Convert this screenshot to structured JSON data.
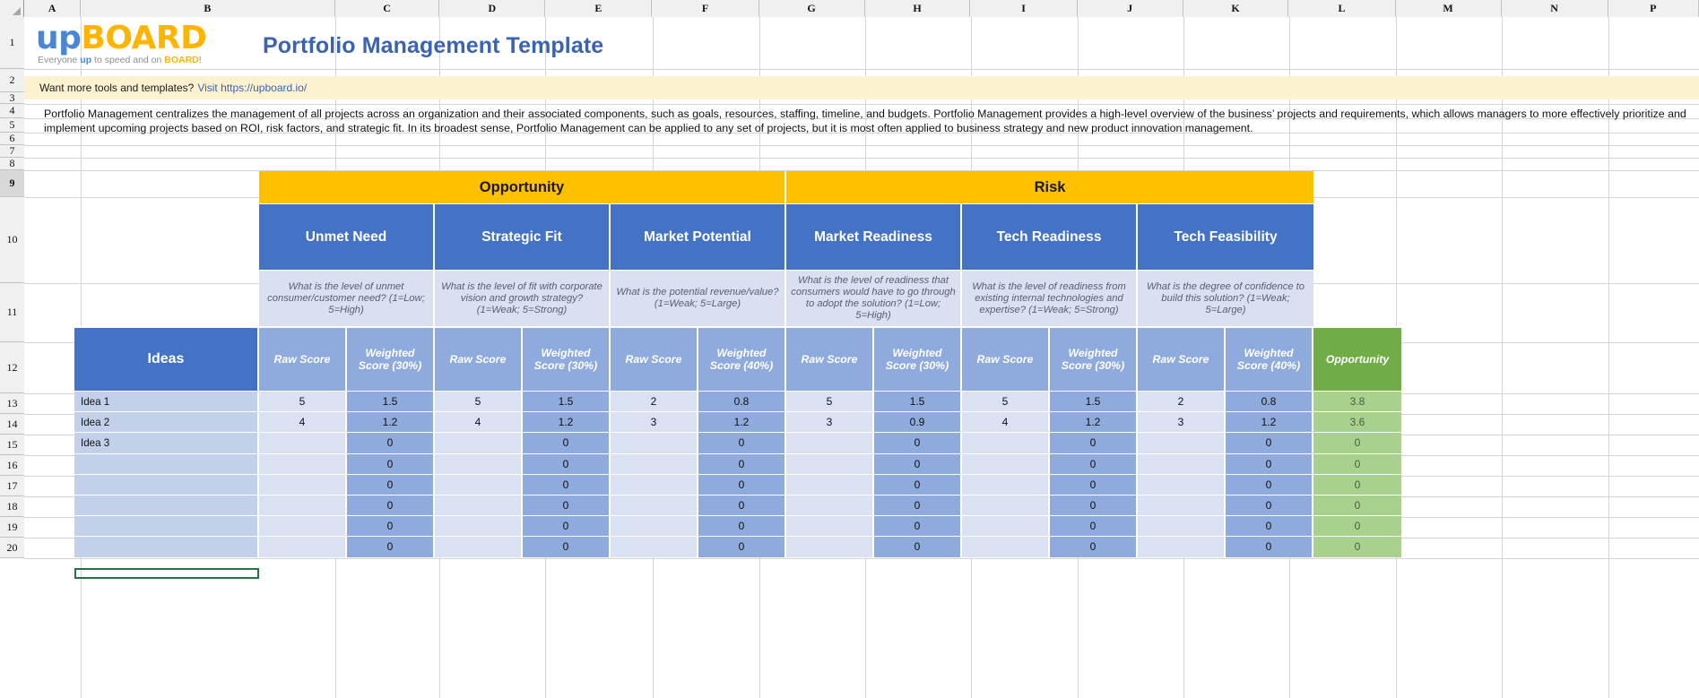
{
  "app": {
    "type": "spreadsheet",
    "select_all_icon": "select-all-triangle-icon"
  },
  "column_headers": [
    "A",
    "B",
    "C",
    "D",
    "E",
    "F",
    "G",
    "H",
    "I",
    "J",
    "K",
    "L",
    "M",
    "N",
    "P"
  ],
  "row_headers": [
    "1",
    "2",
    "3",
    "4",
    "5",
    "6",
    "7",
    "8",
    "9",
    "10",
    "11",
    "12",
    "13",
    "14",
    "15",
    "16",
    "17",
    "18",
    "19",
    "20"
  ],
  "selected_row": "9",
  "logo": {
    "up": "up",
    "board": "BOARD",
    "tagline_pre": "Everyone ",
    "tagline_up": "up",
    "tagline_mid": " to speed and on ",
    "tagline_board": "BOARD",
    "tagline_post": "!"
  },
  "title": "Portfolio Management Template",
  "banner": {
    "text": "Want more tools and templates?",
    "link_text": "Visit https://upboard.io/"
  },
  "description": {
    "line1": "Portfolio Management centralizes the management of all projects across an organization and their associated components, such as goals, resources, staffing, timeline, and budgets. Portfolio Management provides a high-level overview of the business’ projects and requirements, which allows managers to more effectively prioritize and",
    "line2": "implement upcoming projects based on ROI, risk factors, and strategic fit. In its broadest sense, Portfolio Management can be applied to any set of projects, but it is most often applied to business strategy and new product innovation management."
  },
  "matrix": {
    "groups": [
      {
        "label": "Opportunity",
        "span": 3
      },
      {
        "label": "Risk",
        "span": 3
      }
    ],
    "ideas_header": "Ideas",
    "raw_score_label": "Raw Score",
    "criteria": [
      {
        "name": "Unmet Need",
        "question": "What is the level of unmet consumer/customer need?",
        "scale": "(1=Low; 5=High)",
        "weighted_label": "Weighted Score (30%)",
        "weight": "30%"
      },
      {
        "name": "Strategic Fit",
        "question": "What is the level of fit with corporate vision and growth strategy?",
        "scale": "(1=Weak; 5=Strong)",
        "weighted_label": "Weighted Score (30%)",
        "weight": "30%"
      },
      {
        "name": "Market Potential",
        "question": "What is the potential revenue/value?",
        "scale": "(1=Weak; 5=Large)",
        "weighted_label": "Weighted Score (40%)",
        "weight": "40%"
      },
      {
        "name": "Market Readiness",
        "question": "What is the level of readiness that consumers would have to go through to adopt the solution?",
        "scale": "(1=Low; 5=High)",
        "weighted_label": "Weighted Score (30%)",
        "weight": "30%"
      },
      {
        "name": "Tech Readiness",
        "question": "What is the level of readiness from existing internal technologies and expertise?",
        "scale": "(1=Weak; 5=Strong)",
        "weighted_label": "Weighted Score (30%)",
        "weight": "30%"
      },
      {
        "name": "Tech Feasibility",
        "question": "What is the degree of confidence to build this solution?",
        "scale": "(1=Weak; 5=Large)",
        "weighted_label": "Weighted Score (40%)",
        "weight": "40%"
      }
    ],
    "result_column_label": "Opportunity",
    "rows": [
      {
        "idea": "Idea 1",
        "scores": [
          "5",
          "1.5",
          "5",
          "1.5",
          "2",
          "0.8",
          "5",
          "1.5",
          "5",
          "1.5",
          "2",
          "0.8"
        ],
        "result": "3.8"
      },
      {
        "idea": "Idea 2",
        "scores": [
          "4",
          "1.2",
          "4",
          "1.2",
          "3",
          "1.2",
          "3",
          "0.9",
          "4",
          "1.2",
          "3",
          "1.2"
        ],
        "result": "3.6"
      },
      {
        "idea": "Idea 3",
        "scores": [
          "",
          "0",
          "",
          "0",
          "",
          "0",
          "",
          "0",
          "",
          "0",
          "",
          "0"
        ],
        "result": "0"
      },
      {
        "idea": "",
        "scores": [
          "",
          "0",
          "",
          "0",
          "",
          "0",
          "",
          "0",
          "",
          "0",
          "",
          "0"
        ],
        "result": "0"
      },
      {
        "idea": "",
        "scores": [
          "",
          "0",
          "",
          "0",
          "",
          "0",
          "",
          "0",
          "",
          "0",
          "",
          "0"
        ],
        "result": "0"
      },
      {
        "idea": "",
        "scores": [
          "",
          "0",
          "",
          "0",
          "",
          "0",
          "",
          "0",
          "",
          "0",
          "",
          "0"
        ],
        "result": "0"
      },
      {
        "idea": "",
        "scores": [
          "",
          "0",
          "",
          "0",
          "",
          "0",
          "",
          "0",
          "",
          "0",
          "",
          "0"
        ],
        "result": "0"
      },
      {
        "idea": "",
        "scores": [
          "",
          "0",
          "",
          "0",
          "",
          "0",
          "",
          "0",
          "",
          "0",
          "",
          "0"
        ],
        "result": "0"
      }
    ]
  },
  "colors": {
    "group_header": "#FFC000",
    "criteria_header": "#4472C4",
    "description_band": "#DBE0F0",
    "sub_header": "#8FAADC",
    "result_header": "#70AD47",
    "result_cell": "#A9D18E",
    "raw_cell": "#D9E1F2",
    "weighted_cell": "#8FAADC",
    "idea_cell": "#C3D0EA",
    "banner_bg": "#FDF2D0",
    "title_color": "#3B63B0"
  }
}
